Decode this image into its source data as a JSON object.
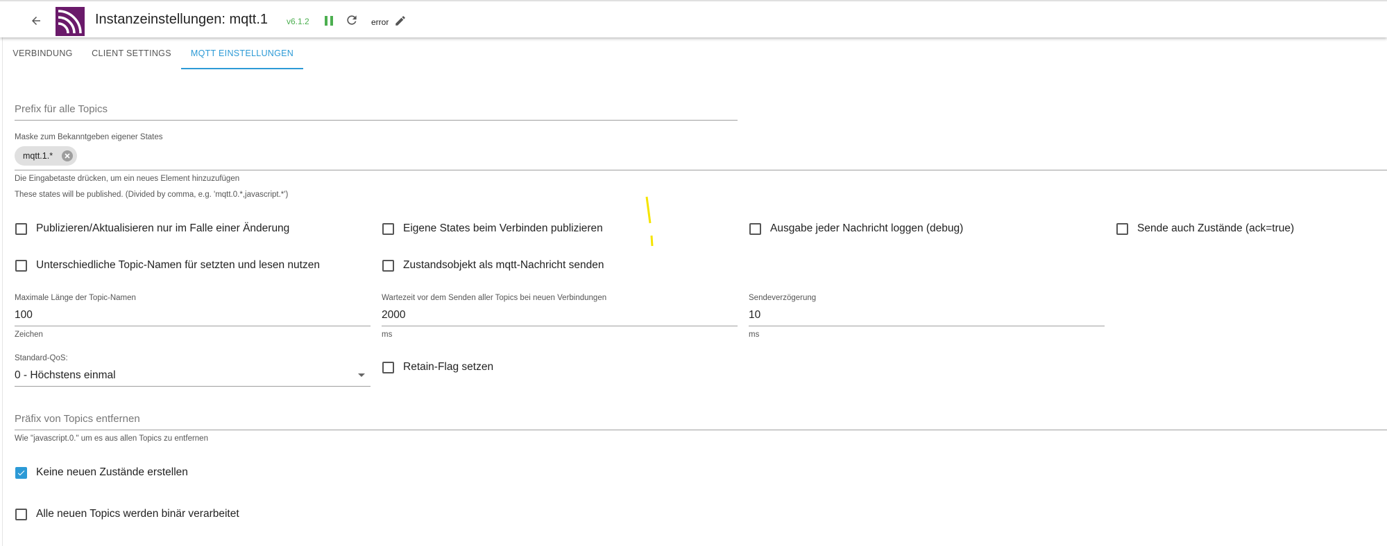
{
  "header": {
    "title": "Instanzeinstellungen: mqtt.1",
    "version": "v6.1.2",
    "status": "error",
    "colors": {
      "logo": "#6a1a6a",
      "version": "#4caf50",
      "accent": "#2c9ad6"
    },
    "icons": [
      "back-arrow-icon",
      "mqtt-logo",
      "pause-icon",
      "reload-icon",
      "pencil-icon"
    ]
  },
  "tabs": [
    {
      "label": "VERBINDUNG",
      "active": false
    },
    {
      "label": "CLIENT SETTINGS",
      "active": false
    },
    {
      "label": "MQTT EINSTELLUNGEN",
      "active": true
    }
  ],
  "form": {
    "prefix": {
      "placeholder": "Prefix für alle Topics",
      "value": ""
    },
    "mask": {
      "label": "Maske zum Bekanntgeben eigener States",
      "chips": [
        "mqtt.1.*"
      ],
      "helper1": "Die Eingabetaste drücken, um ein neues Element hinzuzufügen",
      "helper2": "These states will be published. (Divided by comma, e.g. 'mqtt.0.*,javascript.*')"
    },
    "checkboxes_row1": [
      {
        "label": "Publizieren/Aktualisieren nur im Falle einer Änderung",
        "checked": false
      },
      {
        "label": "Eigene States beim Verbinden publizieren",
        "checked": false
      },
      {
        "label": "Ausgabe jeder Nachricht loggen (debug)",
        "checked": false
      },
      {
        "label": "Sende auch Zustände (ack=true)",
        "checked": false
      }
    ],
    "checkboxes_row2": [
      {
        "label": "Unterschiedliche Topic-Namen für setzten und lesen nutzen",
        "checked": false
      },
      {
        "label": "Zustandsobjekt als mqtt-Nachricht senden",
        "checked": false
      }
    ],
    "max_length": {
      "label": "Maximale Länge der Topic-Namen",
      "value": "100",
      "unit": "Zeichen"
    },
    "wait_time": {
      "label": "Wartezeit vor dem Senden aller Topics bei neuen Verbindungen",
      "value": "2000",
      "unit": "ms"
    },
    "send_delay": {
      "label": "Sendeverzögerung",
      "value": "10",
      "unit": "ms"
    },
    "qos": {
      "label": "Standard-QoS:",
      "value": "0 - Höchstens einmal"
    },
    "retain": {
      "label": "Retain-Flag setzen",
      "checked": false
    },
    "remove_prefix": {
      "placeholder": "Präfix von Topics entfernen",
      "helper": "Wie \"javascript.0.\" um es aus allen Topics zu entfernen"
    },
    "no_new_states": {
      "label": "Keine neuen Zustände erstellen",
      "checked": true
    },
    "binary_topics": {
      "label": "Alle neuen Topics werden binär verarbeitet",
      "checked": false
    }
  }
}
